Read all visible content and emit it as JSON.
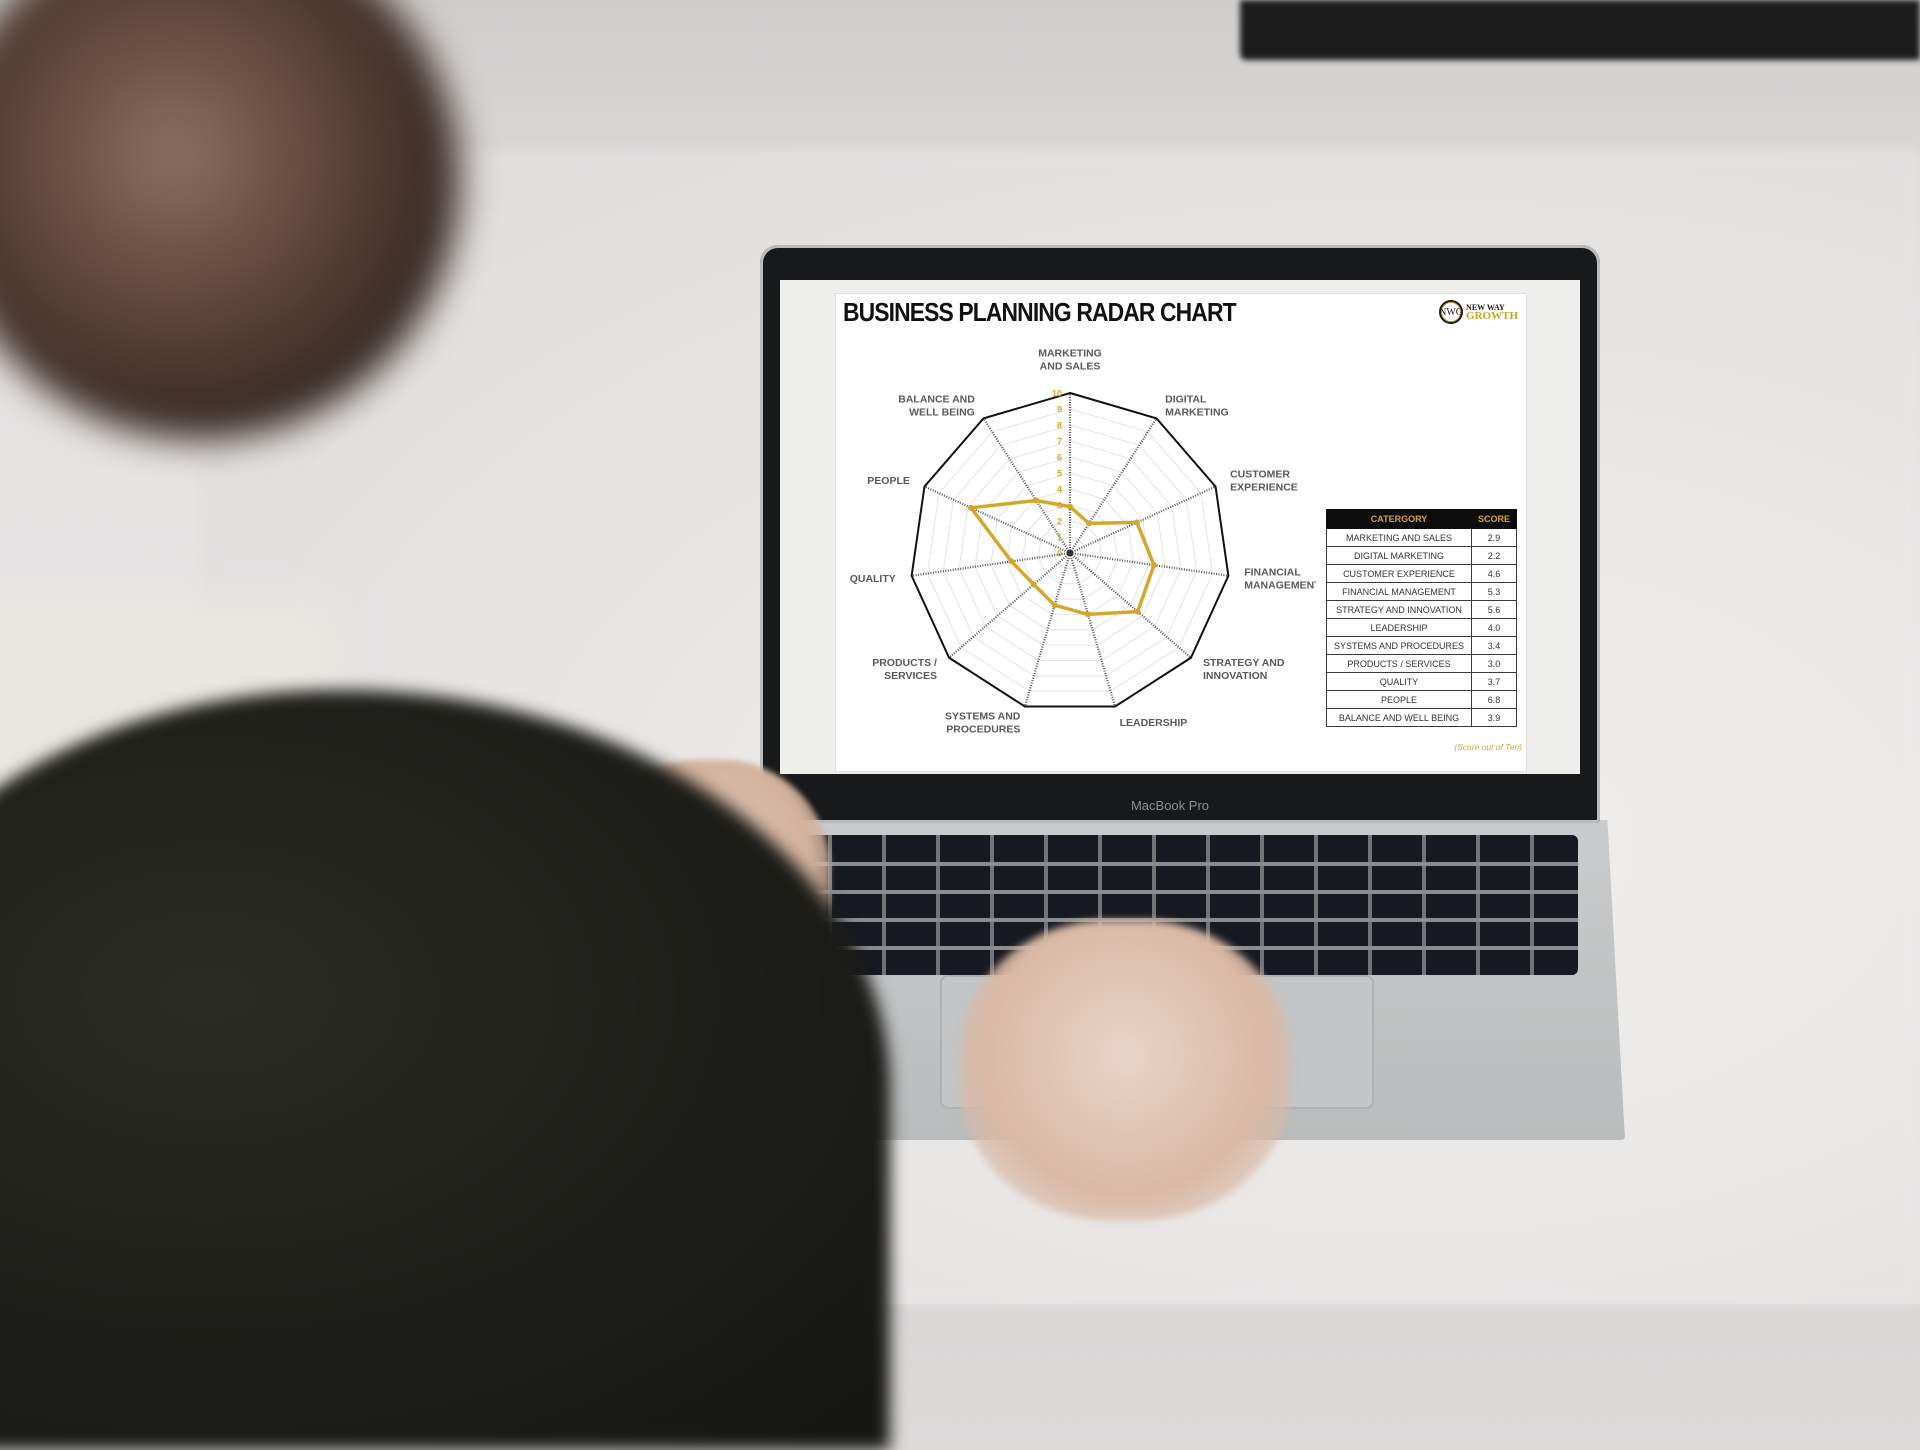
{
  "scene": {
    "device_label": "MacBook Pro"
  },
  "document": {
    "title": "BUSINESS PLANNING RADAR CHART",
    "logo": {
      "mark": "NWG",
      "line1": "NEW WAY",
      "line2": "GROWTH"
    },
    "table": {
      "headers": [
        "CATERGORY",
        "SCORE"
      ],
      "rows": [
        [
          "MARKETING AND SALES",
          "2.9"
        ],
        [
          "DIGITAL MARKETING",
          "2.2"
        ],
        [
          "CUSTOMER EXPERIENCE",
          "4.6"
        ],
        [
          "FINANCIAL MANAGEMENT",
          "5.3"
        ],
        [
          "STRATEGY AND INNOVATION",
          "5.6"
        ],
        [
          "LEADERSHIP",
          "4.0"
        ],
        [
          "SYSTEMS AND PROCEDURES",
          "3.4"
        ],
        [
          "PRODUCTS / SERVICES",
          "3.0"
        ],
        [
          "QUALITY",
          "3.7"
        ],
        [
          "PEOPLE",
          "6.8"
        ],
        [
          "BALANCE AND WELL BEING",
          "3.9"
        ]
      ]
    },
    "footnote": "(Score out of Ten)"
  },
  "colors": {
    "series": "#d4a72c",
    "outer_ring": "#111111",
    "grid": "#e3e3e3",
    "spokes": "#555555",
    "table_header_bg": "#0d0d0d",
    "table_header_text": "#d4a72c"
  },
  "chart_data": {
    "type": "radar",
    "title": "BUSINESS PLANNING RADAR CHART",
    "categories": [
      [
        "MARKETING",
        "AND SALES"
      ],
      [
        "DIGITAL",
        "MARKETING"
      ],
      [
        "CUSTOMER",
        "EXPERIENCE"
      ],
      [
        "FINANCIAL",
        "MANAGEMENT"
      ],
      [
        "STRATEGY AND",
        "INNOVATION"
      ],
      [
        "LEADERSHIP"
      ],
      [
        "SYSTEMS AND",
        "PROCEDURES"
      ],
      [
        "PRODUCTS /",
        "SERVICES"
      ],
      [
        "QUALITY"
      ],
      [
        "PEOPLE"
      ],
      [
        "BALANCE AND",
        "WELL BEING"
      ]
    ],
    "series": [
      {
        "name": "Score",
        "values": [
          2.9,
          2.2,
          4.6,
          5.3,
          5.6,
          4.0,
          3.4,
          3.0,
          3.7,
          6.8,
          3.9
        ]
      }
    ],
    "rlim": [
      0,
      10
    ],
    "ticks": [
      "0",
      "1",
      "2",
      "3",
      "4",
      "5",
      "6",
      "7",
      "8",
      "9",
      "10"
    ],
    "grid": true,
    "legend": "none"
  }
}
